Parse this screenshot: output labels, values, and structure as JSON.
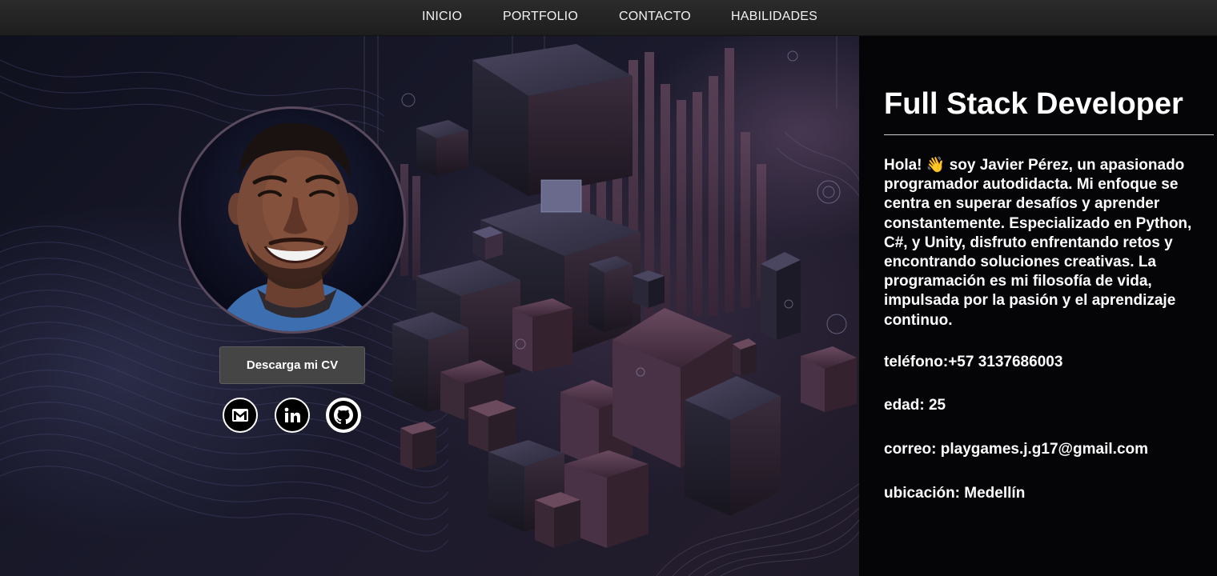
{
  "nav": {
    "items": [
      {
        "label": "INICIO"
      },
      {
        "label": "PORTFOLIO"
      },
      {
        "label": "CONTACTO"
      },
      {
        "label": "HABILIDADES"
      }
    ]
  },
  "profile": {
    "cv_button": "Descarga mi CV",
    "social": [
      {
        "icon": "gmail-icon"
      },
      {
        "icon": "linkedin-icon"
      },
      {
        "icon": "github-icon"
      }
    ]
  },
  "about": {
    "title": "Full Stack Developer",
    "bio": "Hola! 👋 soy Javier Pérez, un apasionado programador autodidacta. Mi enfoque se centra en superar desafíos y aprender constantemente. Especializado en Python, C#, y Unity, disfruto enfrentando retos y encontrando soluciones creativas. La programación es mi filosofía de vida, impulsada por la pasión y el aprendizaje continuo.",
    "phone": "teléfono:+57 3137686003",
    "age": "edad: 25",
    "email": "correo: playgames.j.g17@gmail.com",
    "location": "ubicación: Medellín"
  },
  "colors": {
    "nav_bg": "#2b2b2b",
    "panel_bg": "#050507",
    "button_bg": "#454545",
    "accent_purple": "#5a3a50"
  }
}
